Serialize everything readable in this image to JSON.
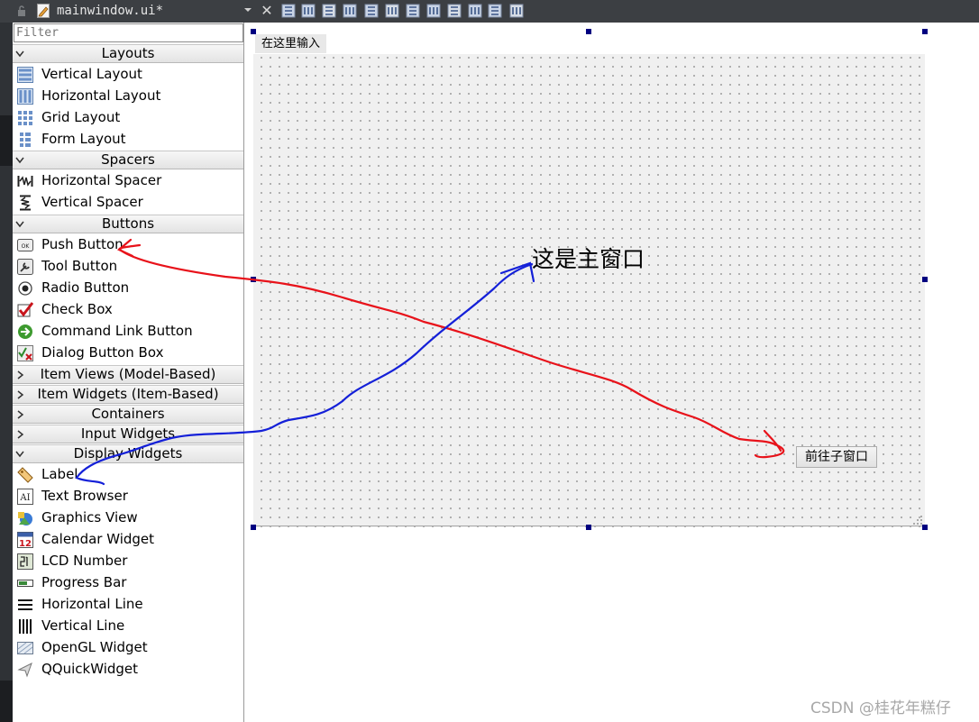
{
  "tab": {
    "file_name": "mainwindow.ui*",
    "close_glyph": "✕"
  },
  "toolbar": {
    "icons": [
      "edit-widgets-icon",
      "edit-signals-slots-icon",
      "edit-buddies-icon",
      "edit-tab-order-icon",
      "lay-out-horizontally-icon",
      "lay-out-vertically-icon",
      "lay-out-horizontal-splitter-icon",
      "lay-out-vertical-splitter-icon",
      "lay-out-form-icon",
      "lay-out-grid-icon",
      "break-layout-icon",
      "adjust-size-icon"
    ]
  },
  "widget_box": {
    "filter_placeholder": "Filter",
    "categories": {
      "layouts": "Layouts",
      "spacers": "Spacers",
      "buttons": "Buttons",
      "item_views": "Item Views (Model-Based)",
      "item_widgets": "Item Widgets (Item-Based)",
      "containers": "Containers",
      "input_widgets": "Input Widgets",
      "display_widgets": "Display Widgets"
    },
    "layouts": [
      "Vertical Layout",
      "Horizontal Layout",
      "Grid Layout",
      "Form Layout"
    ],
    "spacers": [
      "Horizontal Spacer",
      "Vertical Spacer"
    ],
    "buttons": [
      "Push Button",
      "Tool Button",
      "Radio Button",
      "Check Box",
      "Command Link Button",
      "Dialog Button Box"
    ],
    "display_widgets": [
      "Label",
      "Text Browser",
      "Graphics View",
      "Calendar Widget",
      "LCD Number",
      "Progress Bar",
      "Horizontal Line",
      "Vertical Line",
      "OpenGL Widget",
      "QQuickWidget"
    ],
    "calendar_icon_number": "12"
  },
  "form": {
    "menu_placeholder": "在这里输入",
    "main_label": "这是主窗口",
    "goto_button": "前往子窗口"
  },
  "colors": {
    "annotation_red": "#e8121a",
    "annotation_blue": "#1420d8",
    "selection_handle": "#000080"
  },
  "watermark": "CSDN @桂花年糕仔"
}
